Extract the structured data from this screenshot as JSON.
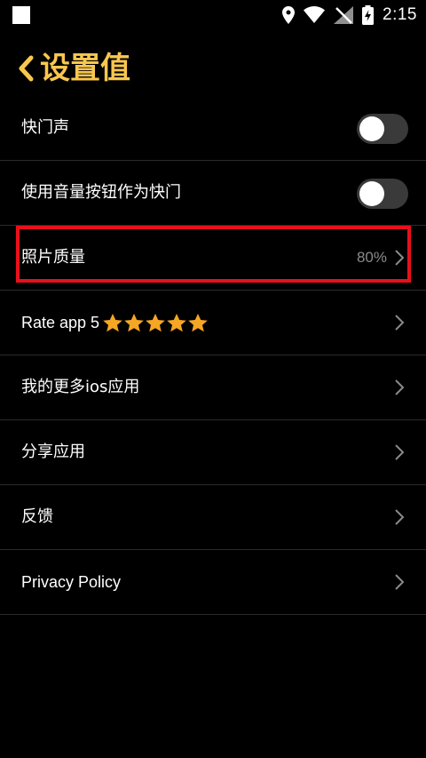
{
  "status_bar": {
    "time": "2:15",
    "icons": [
      "location-icon",
      "wifi-icon",
      "no-signal-icon",
      "battery-charging-icon"
    ]
  },
  "header": {
    "title": "设置值",
    "back_icon": "chevron-left-icon"
  },
  "settings": {
    "shutter_sound": {
      "label": "快门声",
      "enabled": false
    },
    "volume_shutter": {
      "label": "使用音量按钮作为快门",
      "enabled": false
    },
    "photo_quality": {
      "label": "照片质量",
      "value": "80%"
    },
    "rate_app": {
      "label": "Rate app 5",
      "stars": 5
    },
    "more_apps": {
      "label": "我的更多ios应用"
    },
    "share_app": {
      "label": "分享应用"
    },
    "feedback": {
      "label": "反馈"
    },
    "privacy": {
      "label": "Privacy Policy"
    }
  },
  "colors": {
    "accent": "#f9c74f",
    "star": "#f5a623",
    "highlight": "#e8101a",
    "background": "#000000"
  }
}
